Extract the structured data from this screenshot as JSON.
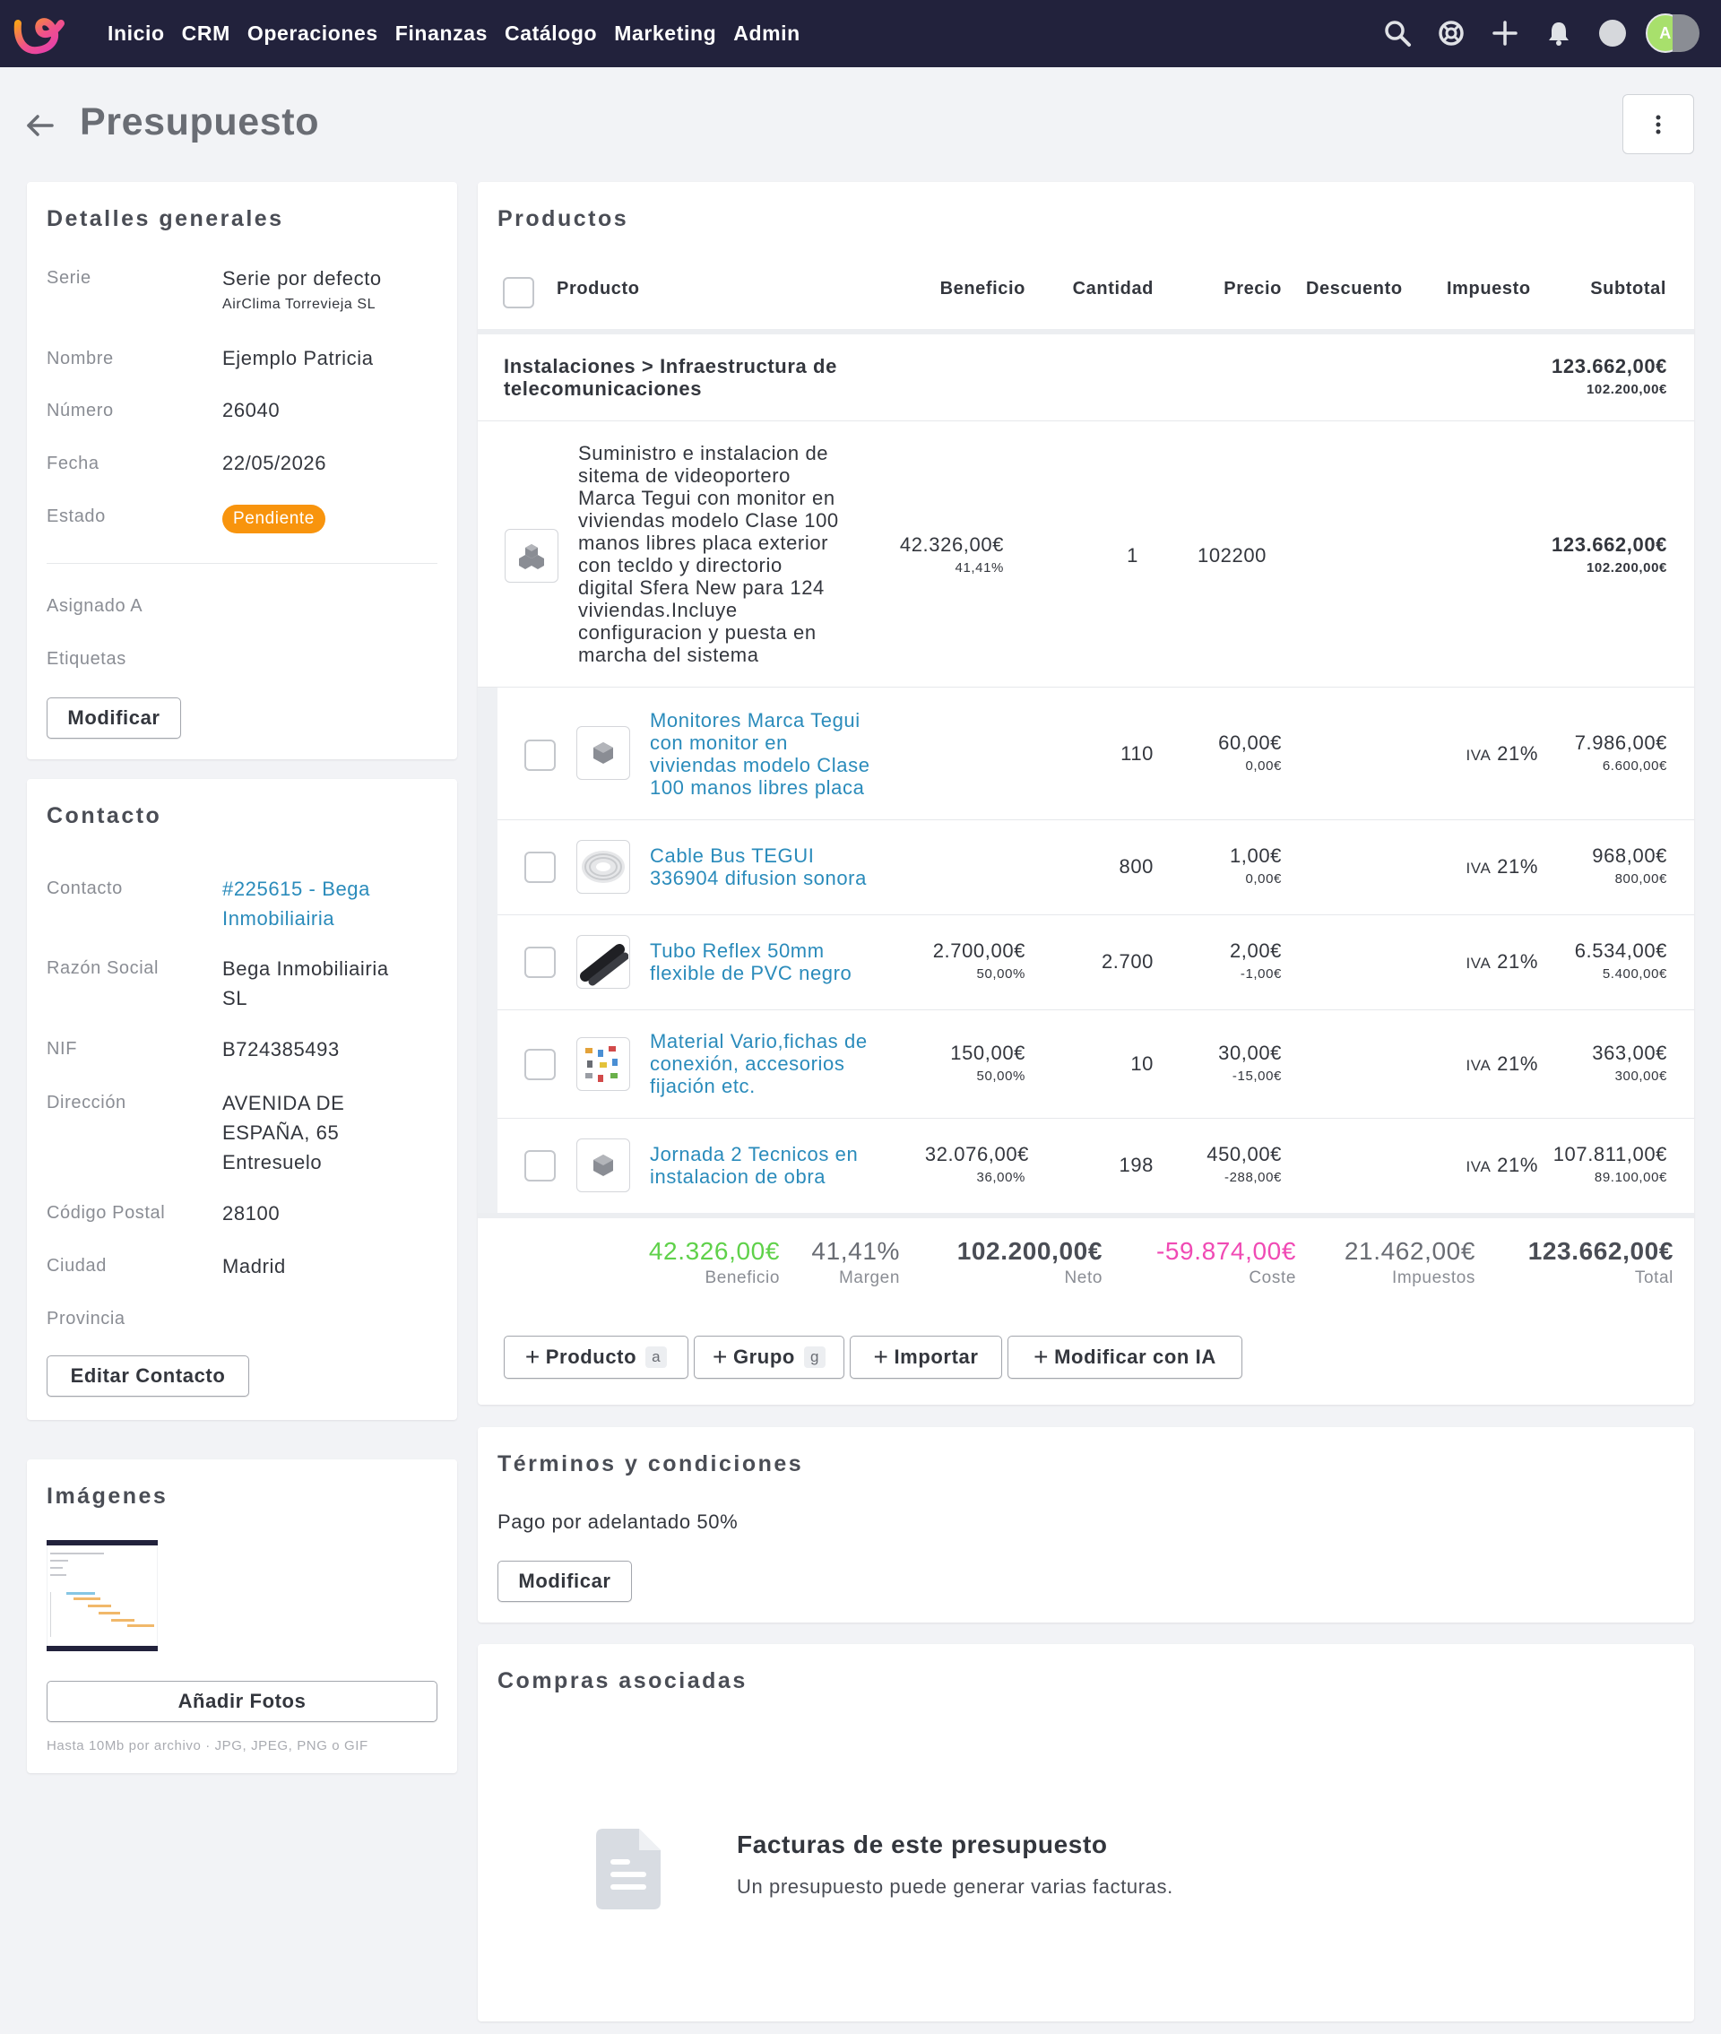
{
  "nav": {
    "items": [
      "Inicio",
      "CRM",
      "Operaciones",
      "Finanzas",
      "Catálogo",
      "Marketing",
      "Admin"
    ],
    "avatar_initial": "A"
  },
  "page": {
    "title": "Presupuesto"
  },
  "general": {
    "title": "Detalles generales",
    "serie_label": "Serie",
    "serie_value": "Serie por defecto",
    "serie_company": "AirClima Torrevieja SL",
    "nombre_label": "Nombre",
    "nombre_value": "Ejemplo Patricia",
    "numero_label": "Número",
    "numero_value": "26040",
    "fecha_label": "Fecha",
    "fecha_value": "22/05/2026",
    "estado_label": "Estado",
    "estado_value": "Pendiente",
    "asignado_label": "Asignado A",
    "etiquetas_label": "Etiquetas",
    "modify_button": "Modificar"
  },
  "contact": {
    "title": "Contacto",
    "contacto_label": "Contacto",
    "contacto_line1": "#225615 - Bega",
    "contacto_line2": "Inmobiliairia",
    "razon_label": "Razón Social",
    "razon_line1": "Bega Inmobiliairia",
    "razon_line2": "SL",
    "nif_label": "NIF",
    "nif_value": "B724385493",
    "direccion_label": "Dirección",
    "direccion_line1": "AVENIDA DE",
    "direccion_line2": "ESPAÑA, 65",
    "direccion_line3": "Entresuelo",
    "cp_label": "Código Postal",
    "cp_value": "28100",
    "ciudad_label": "Ciudad",
    "ciudad_value": "Madrid",
    "provincia_label": "Provincia",
    "edit_button": "Editar Contacto"
  },
  "images": {
    "title": "Imágenes",
    "add_button": "Añadir Fotos",
    "hint": "Hasta 10Mb por archivo · JPG, JPEG, PNG o GIF"
  },
  "products": {
    "title": "Productos",
    "columns": {
      "producto": "Producto",
      "beneficio": "Beneficio",
      "cantidad": "Cantidad",
      "precio": "Precio",
      "descuento": "Descuento",
      "impuesto": "Impuesto",
      "subtotal": "Subtotal"
    },
    "group": {
      "name_line1": "Instalaciones > Infraestructura de",
      "name_line2": "telecomunicaciones",
      "total": "123.662,00€",
      "net": "102.200,00€"
    },
    "parent": {
      "desc": [
        "Suministro e instalacion de",
        "sitema de videoportero",
        "Marca Tegui con monitor en",
        "viviendas modelo Clase 100",
        "manos libres placa exterior",
        "con tecldo y directorio",
        "digital Sfera New para 124",
        "viviendas.Incluye",
        "configuracion y puesta en",
        "marcha del sistema"
      ],
      "beneficio": "42.326,00€",
      "beneficio_pct": "41,41%",
      "cantidad": "1",
      "precio": "102200",
      "subtotal": "123.662,00€",
      "subtotal_net": "102.200,00€"
    },
    "rows": [
      {
        "name": [
          "Monitores Marca Tegui",
          "con monitor en",
          "viviendas modelo Clase",
          "100 manos libres placa"
        ],
        "beneficio": "",
        "beneficio_pct": "",
        "cantidad": "110",
        "precio": "60,00€",
        "coste": "0,00€",
        "iva_label": "IVA",
        "iva": "21%",
        "subtotal": "7.986,00€",
        "net": "6.600,00€"
      },
      {
        "name": [
          "Cable Bus TEGUI",
          "336904 difusion sonora"
        ],
        "beneficio": "",
        "beneficio_pct": "",
        "cantidad": "800",
        "precio": "1,00€",
        "coste": "0,00€",
        "iva_label": "IVA",
        "iva": "21%",
        "subtotal": "968,00€",
        "net": "800,00€"
      },
      {
        "name": [
          "Tubo Reflex 50mm",
          "flexible de PVC negro"
        ],
        "beneficio": "2.700,00€",
        "beneficio_pct": "50,00%",
        "cantidad": "2.700",
        "precio": "2,00€",
        "coste": "-1,00€",
        "iva_label": "IVA",
        "iva": "21%",
        "subtotal": "6.534,00€",
        "net": "5.400,00€"
      },
      {
        "name": [
          "Material Vario,fichas de",
          "conexión, accesorios",
          "fijación etc."
        ],
        "beneficio": "150,00€",
        "beneficio_pct": "50,00%",
        "cantidad": "10",
        "precio": "30,00€",
        "coste": "-15,00€",
        "iva_label": "IVA",
        "iva": "21%",
        "subtotal": "363,00€",
        "net": "300,00€"
      },
      {
        "name": [
          "Jornada 2 Tecnicos en",
          "instalacion de obra"
        ],
        "beneficio": "32.076,00€",
        "beneficio_pct": "36,00%",
        "cantidad": "198",
        "precio": "450,00€",
        "coste": "-288,00€",
        "iva_label": "IVA",
        "iva": "21%",
        "subtotal": "107.811,00€",
        "net": "89.100,00€"
      }
    ],
    "summary": [
      {
        "value": "42.326,00€",
        "label": "Beneficio"
      },
      {
        "value": "41,41%",
        "label": "Margen"
      },
      {
        "value": "102.200,00€",
        "label": "Neto"
      },
      {
        "value": "-59.874,00€",
        "label": "Coste"
      },
      {
        "value": "21.462,00€",
        "label": "Impuestos"
      },
      {
        "value": "123.662,00€",
        "label": "Total"
      }
    ],
    "actions": {
      "producto": "Producto",
      "producto_key": "a",
      "grupo": "Grupo",
      "grupo_key": "g",
      "importar": "Importar",
      "ia": "Modificar con IA"
    }
  },
  "terms": {
    "title": "Términos y condiciones",
    "text": "Pago por adelantado 50%",
    "modify_button": "Modificar"
  },
  "purchases": {
    "title": "Compras asociadas",
    "empty_title": "Facturas de este presupuesto",
    "empty_text": "Un presupuesto puede generar varias facturas."
  },
  "colors": {
    "topbar": "#22223c",
    "accent_orange": "#f8940d",
    "link": "#2a8bbb",
    "positive": "#5fd14a",
    "negative": "#f04ab4"
  }
}
